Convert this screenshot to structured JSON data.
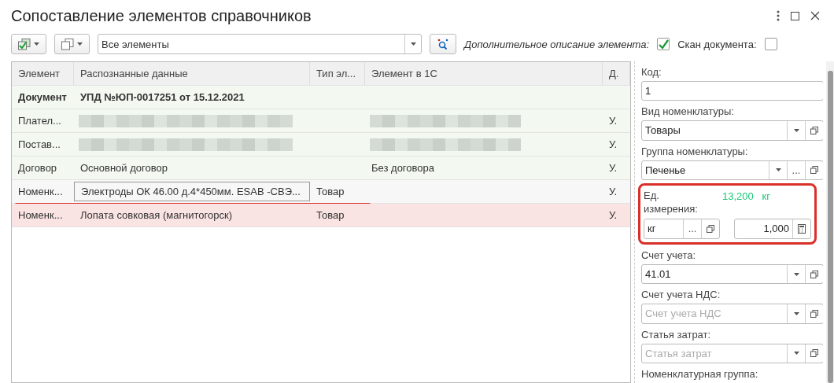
{
  "window": {
    "title": "Сопоставление элементов справочников"
  },
  "toolbar": {
    "filter": {
      "value": "Все элементы"
    },
    "extra_description": {
      "label": "Дополнительное описание элемента:",
      "checked": true
    },
    "scan": {
      "label": "Скан документа:",
      "checked": false
    }
  },
  "table": {
    "columns": [
      "Элемент",
      "Распознанные данные",
      "Тип эл...",
      "Элемент в 1С",
      "Д."
    ],
    "rows": [
      {
        "kind": "document",
        "element": "Документ",
        "recognized": "УПД №ЮП-0017251 от 15.12.2021",
        "selected": false
      },
      {
        "kind": "matched",
        "element": "Плател...",
        "redacted": true,
        "column_5": "У.",
        "selected": false
      },
      {
        "kind": "matched",
        "element": "Постав...",
        "redacted": true,
        "column_5": "У.",
        "selected": false
      },
      {
        "kind": "matched",
        "element": "Договор",
        "recognized": "Основной договор",
        "element_1c": "Без договора",
        "column_5": "У.",
        "selected": false
      },
      {
        "kind": "current",
        "element": "Номенк...",
        "recognized": "Электроды ОК 46.00 д.4*450мм. ESAB -СВЭ...",
        "type": "Товар",
        "column_5": "У.",
        "selected": true,
        "underlined": true
      },
      {
        "kind": "unmatched",
        "element": "Номенк...",
        "recognized": "Лопата совковая (магнитогорск)",
        "type": "Товар",
        "column_5": "У.",
        "selected": false
      }
    ]
  },
  "details": {
    "fields": [
      {
        "kind": "text",
        "label": "Код:",
        "value": "1"
      },
      {
        "kind": "select",
        "label": "Вид номенклатуры:",
        "value": "Товары",
        "buttons": [
          {
            "kind": "dropdown"
          },
          {
            "kind": "open"
          }
        ]
      },
      {
        "kind": "select",
        "label": "Группа номенклатуры:",
        "value": "Печенье",
        "buttons": [
          {
            "kind": "dropdown"
          },
          {
            "kind": "choose",
            "label": "..."
          },
          {
            "kind": "open"
          }
        ]
      },
      {
        "kind": "unit",
        "label": "Ед. измерения:",
        "highlighted": true,
        "quantity": "13,200",
        "quantity_unit": "кг",
        "unit": {
          "value": "кг",
          "buttons": [
            {
              "kind": "choose",
              "label": "..."
            },
            {
              "kind": "open"
            }
          ]
        },
        "coefficient": "1,000"
      },
      {
        "kind": "select",
        "label": "Счет учета:",
        "value": "41.01",
        "buttons": [
          {
            "kind": "dropdown"
          },
          {
            "kind": "open"
          }
        ]
      },
      {
        "kind": "select",
        "label": "Счет учета НДС:",
        "placeholder": "Счет учета НДС",
        "buttons": [
          {
            "kind": "dropdown"
          },
          {
            "kind": "open"
          }
        ]
      },
      {
        "kind": "select",
        "label": "Статья затрат:",
        "placeholder": "Статья затрат",
        "buttons": [
          {
            "kind": "dropdown"
          },
          {
            "kind": "open"
          }
        ]
      },
      {
        "kind": "label",
        "label": "Номенклатурная группа:"
      }
    ]
  }
}
